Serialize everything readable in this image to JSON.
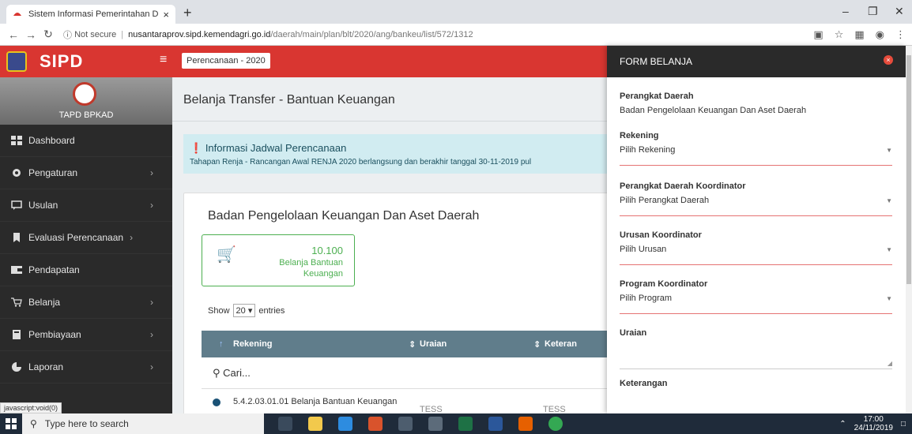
{
  "browser": {
    "tab_title": "Sistem Informasi Pemerintahan D",
    "tab_close": "×",
    "new_tab": "+",
    "security": "Not secure",
    "url_host": "nusantaraprov.sipd.kemendagri.go.id",
    "url_path": "/daerah/main/plan/blt/2020/ang/bankeu/list/572/1312",
    "status_url": "javascript:void(0)"
  },
  "sidebar": {
    "brand": "SIPD",
    "profile_name": "TAPD BPKAD",
    "items": [
      {
        "label": "Dashboard",
        "icon": "dashboard-icon",
        "chevron": ""
      },
      {
        "label": "Pengaturan",
        "icon": "gear-icon",
        "chevron": "›"
      },
      {
        "label": "Usulan",
        "icon": "comment-icon",
        "chevron": "›"
      },
      {
        "label": "Evaluasi Perencanaan",
        "icon": "bookmark-icon",
        "chevron": "›"
      },
      {
        "label": "Pendapatan",
        "icon": "wallet-icon",
        "chevron": ""
      },
      {
        "label": "Belanja",
        "icon": "cart-icon",
        "chevron": "›"
      },
      {
        "label": "Pembiayaan",
        "icon": "calculator-icon",
        "chevron": "›"
      },
      {
        "label": "Laporan",
        "icon": "chart-icon",
        "chevron": "›"
      }
    ]
  },
  "topbar": {
    "hamburger": "≡",
    "period": "Perencanaan - 2020"
  },
  "main": {
    "page_title": "Belanja Transfer - Bantuan Keuangan",
    "info_title": "Informasi Jadwal Perencanaan",
    "info_text": "Tahapan Renja - Rancangan Awal RENJA 2020 berlangsung dan berakhir tanggal 30-11-2019 pul",
    "card_title": "Badan Pengelolaan Keuangan Dan Aset Daerah",
    "stat_value": "10.100",
    "stat_label": "Belanja Bantuan Keuangan",
    "show_label": "Show",
    "entries_value": "20",
    "entries_label": "entries",
    "columns": [
      "Rekening",
      "Uraian",
      "Keteran"
    ],
    "search_placeholder": "Cari...",
    "row": {
      "rekening": "5.4.2.03.01.01 Belanja Bantuan Keuangan",
      "uraian": "TESS",
      "keterangan": "TESS"
    }
  },
  "form": {
    "title": "FORM BELANJA",
    "close": "×",
    "perangkat_label": "Perangkat Daerah",
    "perangkat_value": "Badan Pengelolaan Keuangan Dan Aset Daerah",
    "rekening_label": "Rekening",
    "rekening_value": "Pilih Rekening",
    "pd_koord_label": "Perangkat Daerah Koordinator",
    "pd_koord_value": "Pilih Perangkat Daerah",
    "urusan_label": "Urusan Koordinator",
    "urusan_value": "Pilih Urusan",
    "program_label": "Program Koordinator",
    "program_value": "Pilih Program",
    "uraian_label": "Uraian",
    "keterangan_label": "Keterangan"
  },
  "taskbar": {
    "search_placeholder": "Type here to search",
    "time": "17:00",
    "date": "24/11/2019"
  },
  "colors": {
    "brand_red": "#d93631",
    "sidebar_bg": "#2a2a2a",
    "table_header": "#607d8b",
    "success_green": "#4caf50"
  }
}
